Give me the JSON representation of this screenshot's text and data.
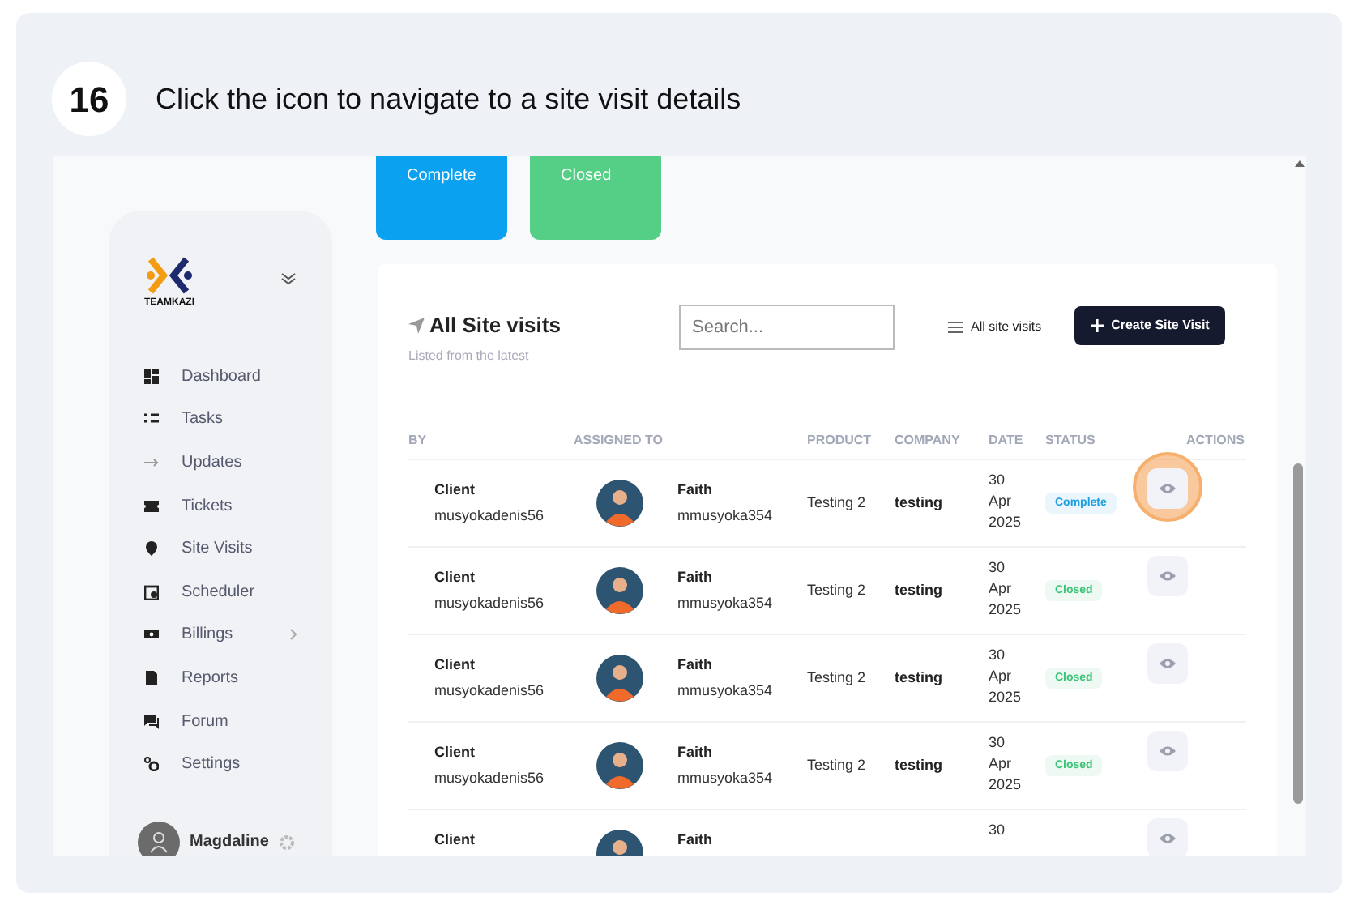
{
  "step": {
    "number": "16",
    "instruction": "Click the icon to navigate to a site visit details"
  },
  "status_cards": [
    {
      "label": "Complete",
      "color": "#0aa1f0"
    },
    {
      "label": "Closed",
      "color": "#55cf86"
    }
  ],
  "sidebar": {
    "logo_text": "TEAMKAZI",
    "items": [
      {
        "label": "Dashboard",
        "has_submenu": false
      },
      {
        "label": "Tasks",
        "has_submenu": false
      },
      {
        "label": "Updates",
        "has_submenu": false
      },
      {
        "label": "Tickets",
        "has_submenu": false
      },
      {
        "label": "Site Visits",
        "has_submenu": false
      },
      {
        "label": "Scheduler",
        "has_submenu": false
      },
      {
        "label": "Billings",
        "has_submenu": true
      },
      {
        "label": "Reports",
        "has_submenu": false
      },
      {
        "label": "Forum",
        "has_submenu": false
      },
      {
        "label": "Settings",
        "has_submenu": false
      }
    ],
    "user": {
      "name": "Magdaline"
    }
  },
  "panel": {
    "title": "All Site visits",
    "subtitle": "Listed from the latest",
    "search": {
      "placeholder": "Search..."
    },
    "filter": "All site visits",
    "create_button": "Create Site Visit"
  },
  "table": {
    "columns": [
      "BY",
      "ASSIGNED TO",
      "PRODUCT",
      "COMPANY",
      "DATE",
      "STATUS",
      "ACTIONS"
    ],
    "rows": [
      {
        "by_name": "Client",
        "by_email": "musyokadenis56",
        "assignee_name": "Faith",
        "assignee_email": "mmusyoka354",
        "product": "Testing 2",
        "company": "testing",
        "date": [
          "30",
          "Apr",
          "2025"
        ],
        "status": "Complete",
        "color": "#1ea0e0",
        "highlighted": true
      },
      {
        "by_name": "Client",
        "by_email": "musyokadenis56",
        "assignee_name": "Faith",
        "assignee_email": "mmusyoka354",
        "product": "Testing 2",
        "company": "testing",
        "date": [
          "30",
          "Apr",
          "2025"
        ],
        "status": "Closed",
        "color": "#3cc477",
        "highlighted": false
      },
      {
        "by_name": "Client",
        "by_email": "musyokadenis56",
        "assignee_name": "Faith",
        "assignee_email": "mmusyoka354",
        "product": "Testing 2",
        "company": "testing",
        "date": [
          "30",
          "Apr",
          "2025"
        ],
        "status": "Closed",
        "color": "#3cc477",
        "highlighted": false
      },
      {
        "by_name": "Client",
        "by_email": "musyokadenis56",
        "assignee_name": "Faith",
        "assignee_email": "mmusyoka354",
        "product": "Testing 2",
        "company": "testing",
        "date": [
          "30",
          "Apr",
          "2025"
        ],
        "status": "Closed",
        "color": "#3cc477",
        "highlighted": false
      },
      {
        "by_name": "Client",
        "assignee_name": "Faith",
        "date": [
          "30"
        ],
        "highlighted": false
      }
    ]
  }
}
